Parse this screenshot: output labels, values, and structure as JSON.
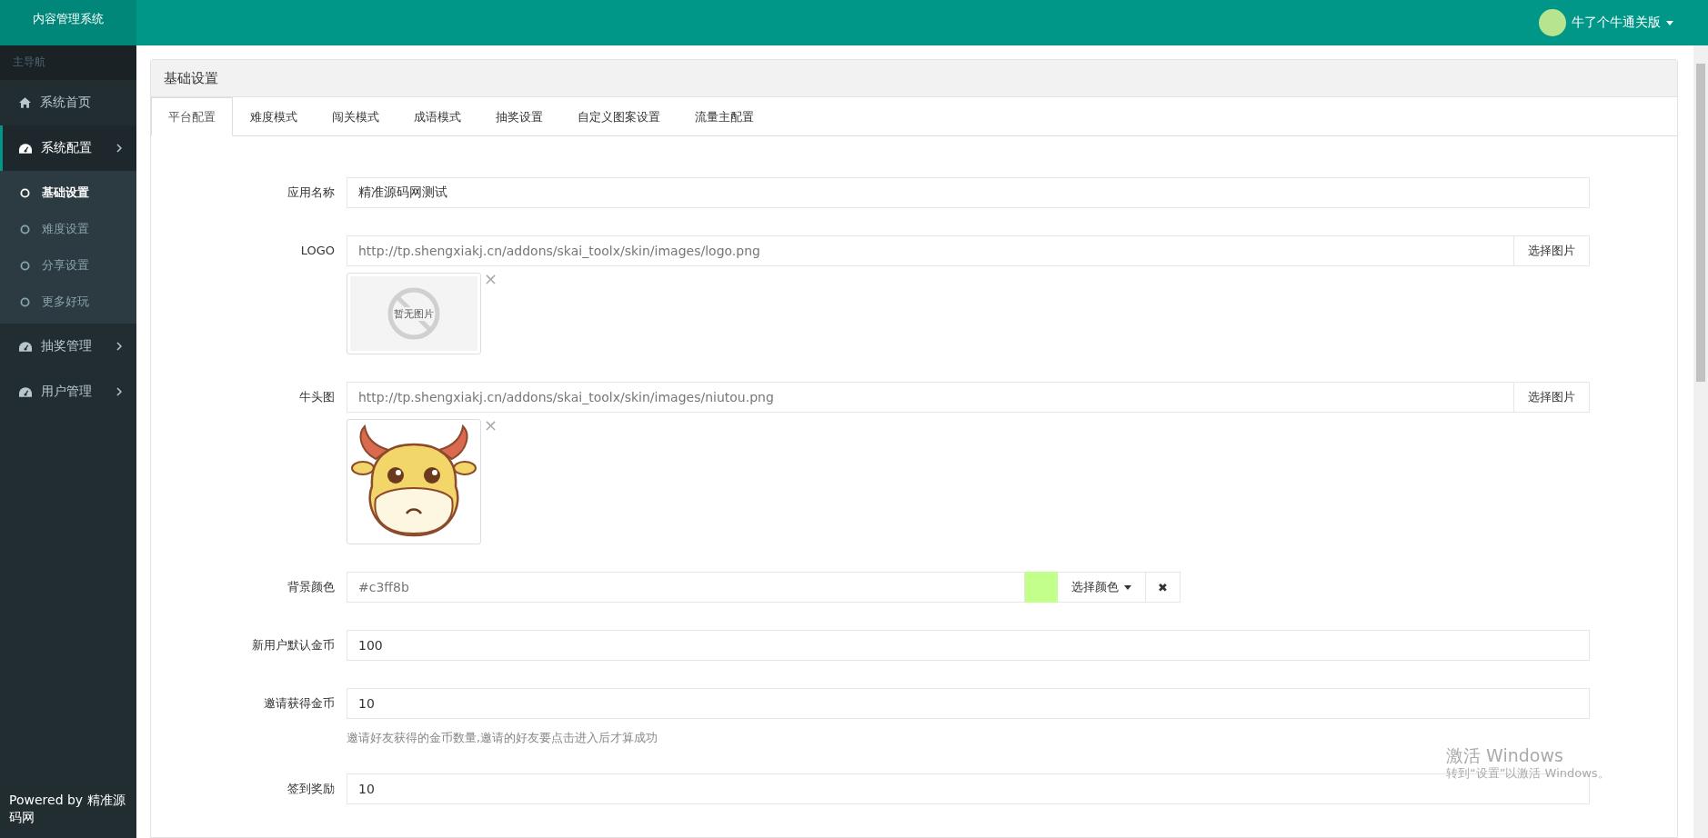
{
  "brand": "内容管理系统",
  "user": {
    "name": "牛了个牛通关版"
  },
  "sidebar": {
    "heading": "主导航",
    "items": [
      {
        "kind": "link",
        "label": "系统首页",
        "selected": false
      },
      {
        "kind": "menu",
        "label": "系统配置",
        "selected": true,
        "expanded": true,
        "children": [
          {
            "label": "基础设置",
            "selected": true
          },
          {
            "label": "难度设置",
            "selected": false
          },
          {
            "label": "分享设置",
            "selected": false
          },
          {
            "label": "更多好玩",
            "selected": false
          }
        ]
      },
      {
        "kind": "menu",
        "label": "抽奖管理",
        "selected": false
      },
      {
        "kind": "menu",
        "label": "用户管理",
        "selected": false
      }
    ],
    "footer": "Powered by 精准源码网"
  },
  "panel": {
    "title": "基础设置",
    "tabs": [
      {
        "label": "平台配置",
        "selected": true
      },
      {
        "label": "难度模式",
        "selected": false
      },
      {
        "label": "闯关模式",
        "selected": false
      },
      {
        "label": "成语模式",
        "selected": false
      },
      {
        "label": "抽奖设置",
        "selected": false
      },
      {
        "label": "自定义图案设置",
        "selected": false
      },
      {
        "label": "流量主配置",
        "selected": false
      }
    ],
    "fields": [
      {
        "kind": "text",
        "label": "应用名称",
        "value": "精准源码网测试",
        "readonly": false
      },
      {
        "kind": "image",
        "label": "LOGO",
        "value": "http://tp.shengxiakj.cn/addons/skai_toolx/skin/images/logo.png",
        "readonly": true,
        "button": "选择图片",
        "preview": {
          "kind": "empty",
          "text": "暂无图片",
          "remove": "×"
        }
      },
      {
        "kind": "image",
        "label": "牛头图",
        "value": "http://tp.shengxiakj.cn/addons/skai_toolx/skin/images/niutou.png",
        "readonly": true,
        "button": "选择图片",
        "preview": {
          "kind": "cow",
          "remove": "×"
        }
      },
      {
        "kind": "color",
        "label": "背景颜色",
        "value": "#c3ff8b",
        "readonly": true,
        "color": "#c3ff8b",
        "button": "选择颜色",
        "clear": "✖"
      },
      {
        "kind": "text",
        "label": "新用户默认金币",
        "value": "100",
        "readonly": false
      },
      {
        "kind": "text",
        "label": "邀请获得金币",
        "value": "10",
        "readonly": false,
        "help": "邀请好友获得的金币数量,邀请的好友要点击进入后才算成功"
      },
      {
        "kind": "text",
        "label": "签到奖励",
        "value": "10",
        "readonly": false
      }
    ]
  },
  "os_notice": {
    "title": "激活 Windows",
    "text": "转到“设置”以激活 Windows。"
  }
}
